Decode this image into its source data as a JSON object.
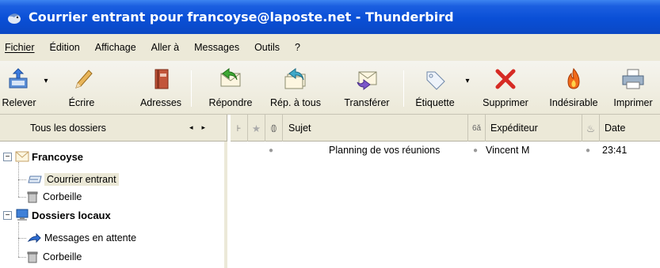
{
  "window": {
    "title": "Courrier entrant pour francoyse@laposte.net - Thunderbird"
  },
  "menu": [
    {
      "label": "Fichier"
    },
    {
      "label": "Édition"
    },
    {
      "label": "Affichage"
    },
    {
      "label": "Aller à"
    },
    {
      "label": "Messages"
    },
    {
      "label": "Outils"
    },
    {
      "label": "?"
    }
  ],
  "toolbar": {
    "get": "Relever",
    "write": "Écrire",
    "address": "Adresses",
    "reply": "Répondre",
    "reply_all": "Rép. à tous",
    "forward": "Transférer",
    "tag": "Étiquette",
    "delete": "Supprimer",
    "junk": "Indésirable",
    "print": "Imprimer"
  },
  "folder_pane": {
    "header": "Tous les dossiers",
    "accounts": [
      {
        "name": "Francoyse",
        "folders": [
          "Courrier entrant",
          "Corbeille"
        ]
      },
      {
        "name": "Dossiers locaux",
        "folders": [
          "Messages en attente",
          "Corbeille"
        ]
      }
    ]
  },
  "columns": {
    "subject": "Sujet",
    "sender": "Expéditeur",
    "date": "Date"
  },
  "messages": [
    {
      "subject": "Planning de vos réunions",
      "sender": "Vincent M",
      "date": "23:41"
    }
  ],
  "colors": {
    "title_bar": "#0a4fd6",
    "chrome": "#ece9d8"
  }
}
